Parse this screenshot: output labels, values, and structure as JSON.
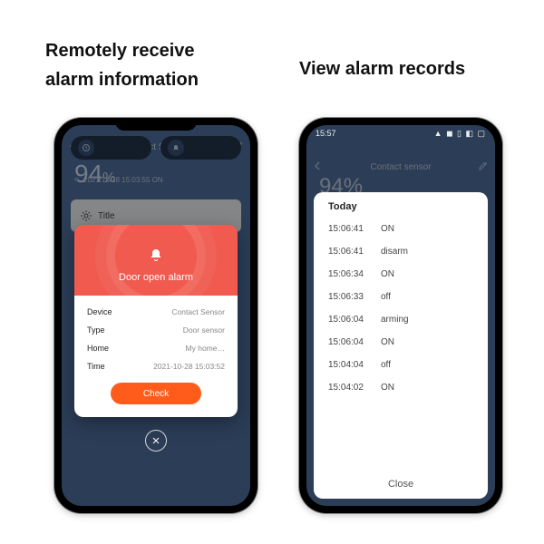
{
  "captions": {
    "left_line1": "Remotely receive",
    "left_line2": "alarm information",
    "right": "View alarm records"
  },
  "left_phone": {
    "app_title": "Contact Sensor",
    "battery": "94",
    "battery_unit": "%",
    "tab_left": "",
    "tab_right": "",
    "record_line": "2021/10/28  15:03:55  ON",
    "bottom_card_label": "Title",
    "modal": {
      "title": "Door open alarm",
      "rows": [
        {
          "k": "Device",
          "v": "Contact Sensor"
        },
        {
          "k": "Type",
          "v": "Door sensor"
        },
        {
          "k": "Home",
          "v": "My home…"
        },
        {
          "k": "Time",
          "v": "2021-10-28  15:03:52"
        }
      ],
      "button": "Check"
    }
  },
  "right_phone": {
    "statusbar_time": "15:57",
    "statusbar_icons": "▲ ◼ ▯ ◧ ▢",
    "app_title": "Contact sensor",
    "battery": "94",
    "battery_unit": "%",
    "sheet_title": "Today",
    "records": [
      {
        "t": "15:06:41",
        "s": "ON"
      },
      {
        "t": "15:06:41",
        "s": "disarm"
      },
      {
        "t": "15:06:34",
        "s": "ON"
      },
      {
        "t": "15:06:33",
        "s": "off"
      },
      {
        "t": "15:06:04",
        "s": "arming"
      },
      {
        "t": "15:06:04",
        "s": "ON"
      },
      {
        "t": "15:04:04",
        "s": "off"
      },
      {
        "t": "15:04:02",
        "s": "ON"
      }
    ],
    "close": "Close"
  }
}
